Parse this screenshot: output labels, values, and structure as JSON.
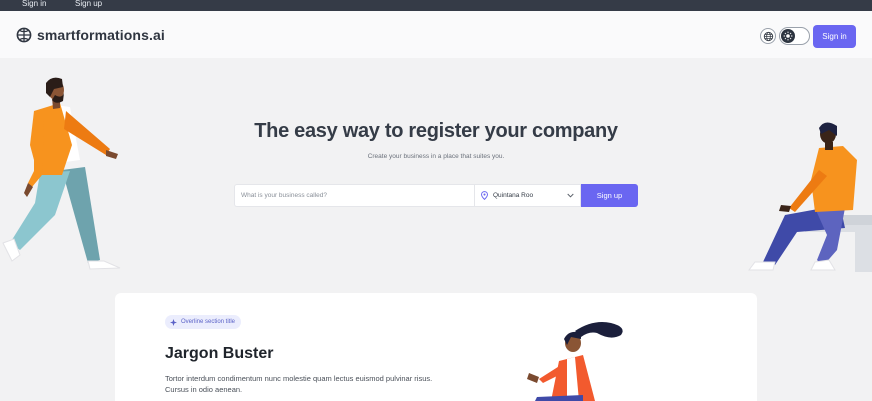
{
  "top_links": {
    "signin": "Sign in",
    "signup": "Sign up"
  },
  "header": {
    "logo_text": "smartformations.ai",
    "globe_icon": "globe-icon",
    "theme_toggle_icon": "sun-icon",
    "signin_label": "Sign in"
  },
  "hero": {
    "title": "The easy way to register your company",
    "subtitle": "Create your business in a place that suites you.",
    "search": {
      "placeholder": "What is your business called?",
      "location_value": "Quintana Roo",
      "location_icon": "map-pin-icon",
      "submit_label": "Sign up"
    }
  },
  "section": {
    "overline": "Overline section title",
    "overline_icon": "sparkle-icon",
    "title": "Jargon Buster",
    "body": "Tortor interdum condimentum nunc molestie quam lectus euismod pulvinar risus. Cursus in odio aenean."
  },
  "colors": {
    "accent": "#6a66f1",
    "topstrip": "#353b47",
    "page_bg": "#f2f2f3",
    "orange": "#f7931e"
  }
}
